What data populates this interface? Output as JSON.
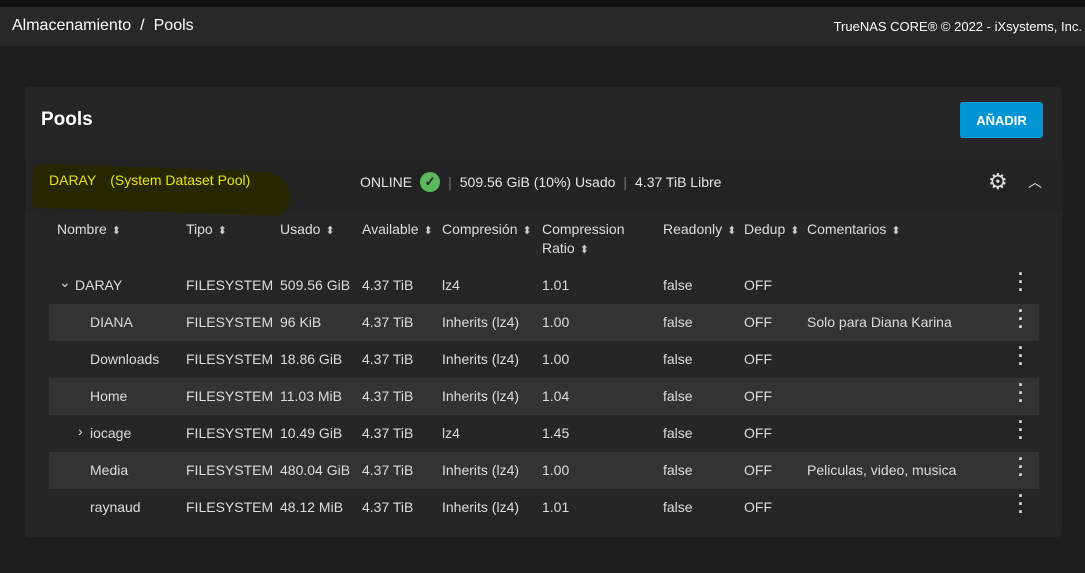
{
  "header": {
    "breadcrumb": [
      "Almacenamiento",
      "Pools"
    ],
    "separator": "/",
    "copyright": "TrueNAS CORE® © 2022 - iXsystems, Inc."
  },
  "card": {
    "title": "Pools",
    "add_label": "AÑADIR"
  },
  "pool": {
    "name": "DARAY",
    "tag": "(System Dataset Pool)",
    "status": "ONLINE",
    "used": "509.56 GiB (10%) Usado",
    "free": "4.37 TiB Libre",
    "bar": "|"
  },
  "columns": [
    {
      "label": "Nombre",
      "sort": "⬍"
    },
    {
      "label": "Tipo",
      "sort": "⬍"
    },
    {
      "label": "Usado",
      "sort": "⬍"
    },
    {
      "label": "Available",
      "sort": "⬍"
    },
    {
      "label": "Compresión",
      "sort": "⬍"
    },
    {
      "label": "Compression Ratio",
      "sort": "⬍"
    },
    {
      "label": "Readonly",
      "sort": "⬍"
    },
    {
      "label": "Dedup",
      "sort": "⬍"
    },
    {
      "label": "Comentarios",
      "sort": "⬍"
    }
  ],
  "rows": [
    {
      "expander": "⌄",
      "name": "DARAY",
      "type": "FILESYSTEM",
      "used": "509.56 GiB",
      "available": "4.37 TiB",
      "compression": "lz4",
      "ratio": "1.01",
      "readonly": "false",
      "dedup": "OFF",
      "comments": ""
    },
    {
      "expander": "",
      "name": "DIANA",
      "type": "FILESYSTEM",
      "used": "96 KiB",
      "available": "4.37 TiB",
      "compression": "Inherits (lz4)",
      "ratio": "1.00",
      "readonly": "false",
      "dedup": "OFF",
      "comments": "Solo para Diana Karina"
    },
    {
      "expander": "",
      "name": "Downloads",
      "type": "FILESYSTEM",
      "used": "18.86 GiB",
      "available": "4.37 TiB",
      "compression": "Inherits (lz4)",
      "ratio": "1.00",
      "readonly": "false",
      "dedup": "OFF",
      "comments": ""
    },
    {
      "expander": "",
      "name": "Home",
      "type": "FILESYSTEM",
      "used": "11.03 MiB",
      "available": "4.37 TiB",
      "compression": "Inherits (lz4)",
      "ratio": "1.04",
      "readonly": "false",
      "dedup": "OFF",
      "comments": ""
    },
    {
      "expander": "›",
      "name": "iocage",
      "type": "FILESYSTEM",
      "used": "10.49 GiB",
      "available": "4.37 TiB",
      "compression": "lz4",
      "ratio": "1.45",
      "readonly": "false",
      "dedup": "OFF",
      "comments": ""
    },
    {
      "expander": "",
      "name": "Media",
      "type": "FILESYSTEM",
      "used": "480.04 GiB",
      "available": "4.37 TiB",
      "compression": "Inherits (lz4)",
      "ratio": "1.00",
      "readonly": "false",
      "dedup": "OFF",
      "comments": "Peliculas, video, musica"
    },
    {
      "expander": "",
      "name": "raynaud",
      "type": "FILESYSTEM",
      "used": "48.12 MiB",
      "available": "4.37 TiB",
      "compression": "Inherits (lz4)",
      "ratio": "1.01",
      "readonly": "false",
      "dedup": "OFF",
      "comments": ""
    }
  ]
}
